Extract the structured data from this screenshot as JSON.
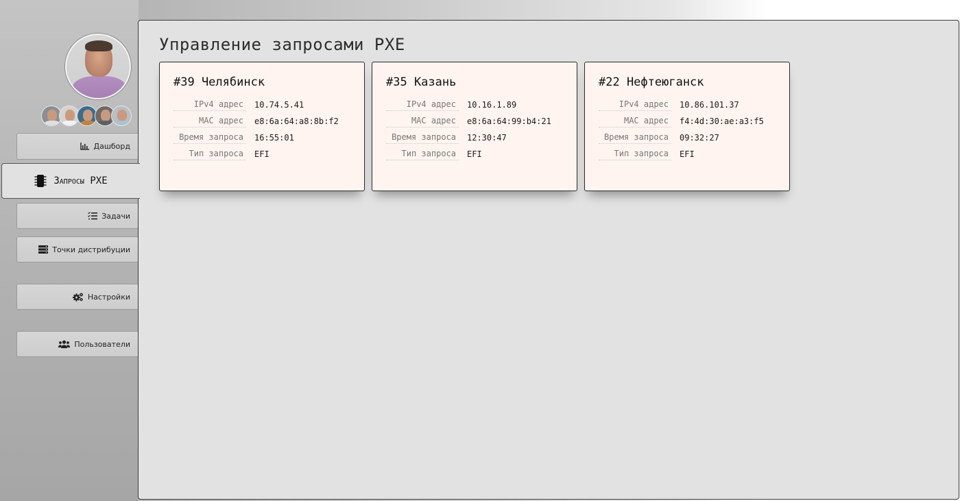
{
  "page": {
    "title": "Управление запросами PXE"
  },
  "sidebar": {
    "avatar_alt": "user-avatar",
    "team_count": 5,
    "items": [
      {
        "label": "Дашборд",
        "icon": "bar-chart-icon",
        "active": false
      },
      {
        "label": "Запросы PXE",
        "icon": "chip-icon",
        "active": true
      },
      {
        "label": "Задачи",
        "icon": "task-list-icon",
        "active": false
      },
      {
        "label": "Точки дистрибуции",
        "icon": "server-icon",
        "active": false
      },
      {
        "label": "Настройки",
        "icon": "gears-icon",
        "active": false
      },
      {
        "label": "Пользователи",
        "icon": "users-icon",
        "active": false
      }
    ]
  },
  "requests": [
    {
      "title": "#39 Челябинск",
      "fields": [
        {
          "key": "IPv4 адрес",
          "value": "10.74.5.41"
        },
        {
          "key": "MAC адрес",
          "value": "e8:6a:64:a8:8b:f2"
        },
        {
          "key": "Время запроса",
          "value": "16:55:01"
        },
        {
          "key": "Тип запроса",
          "value": "EFI"
        }
      ]
    },
    {
      "title": "#35 Казань",
      "fields": [
        {
          "key": "IPv4 адрес",
          "value": "10.16.1.89"
        },
        {
          "key": "MAC адрес",
          "value": "e8:6a:64:99:b4:21"
        },
        {
          "key": "Время запроса",
          "value": "12:30:47"
        },
        {
          "key": "Тип запроса",
          "value": "EFI"
        }
      ]
    },
    {
      "title": "#22 Нефтеюганск",
      "fields": [
        {
          "key": "IPv4 адрес",
          "value": "10.86.101.37"
        },
        {
          "key": "MAC адрес",
          "value": "f4:4d:30:ae:a3:f5"
        },
        {
          "key": "Время запроса",
          "value": "09:32:27"
        },
        {
          "key": "Тип запроса",
          "value": "EFI"
        }
      ]
    }
  ],
  "colors": {
    "card_bg": "#fff4f0",
    "panel_bg": "#e2e2e2",
    "border": "#2a2a2a"
  }
}
